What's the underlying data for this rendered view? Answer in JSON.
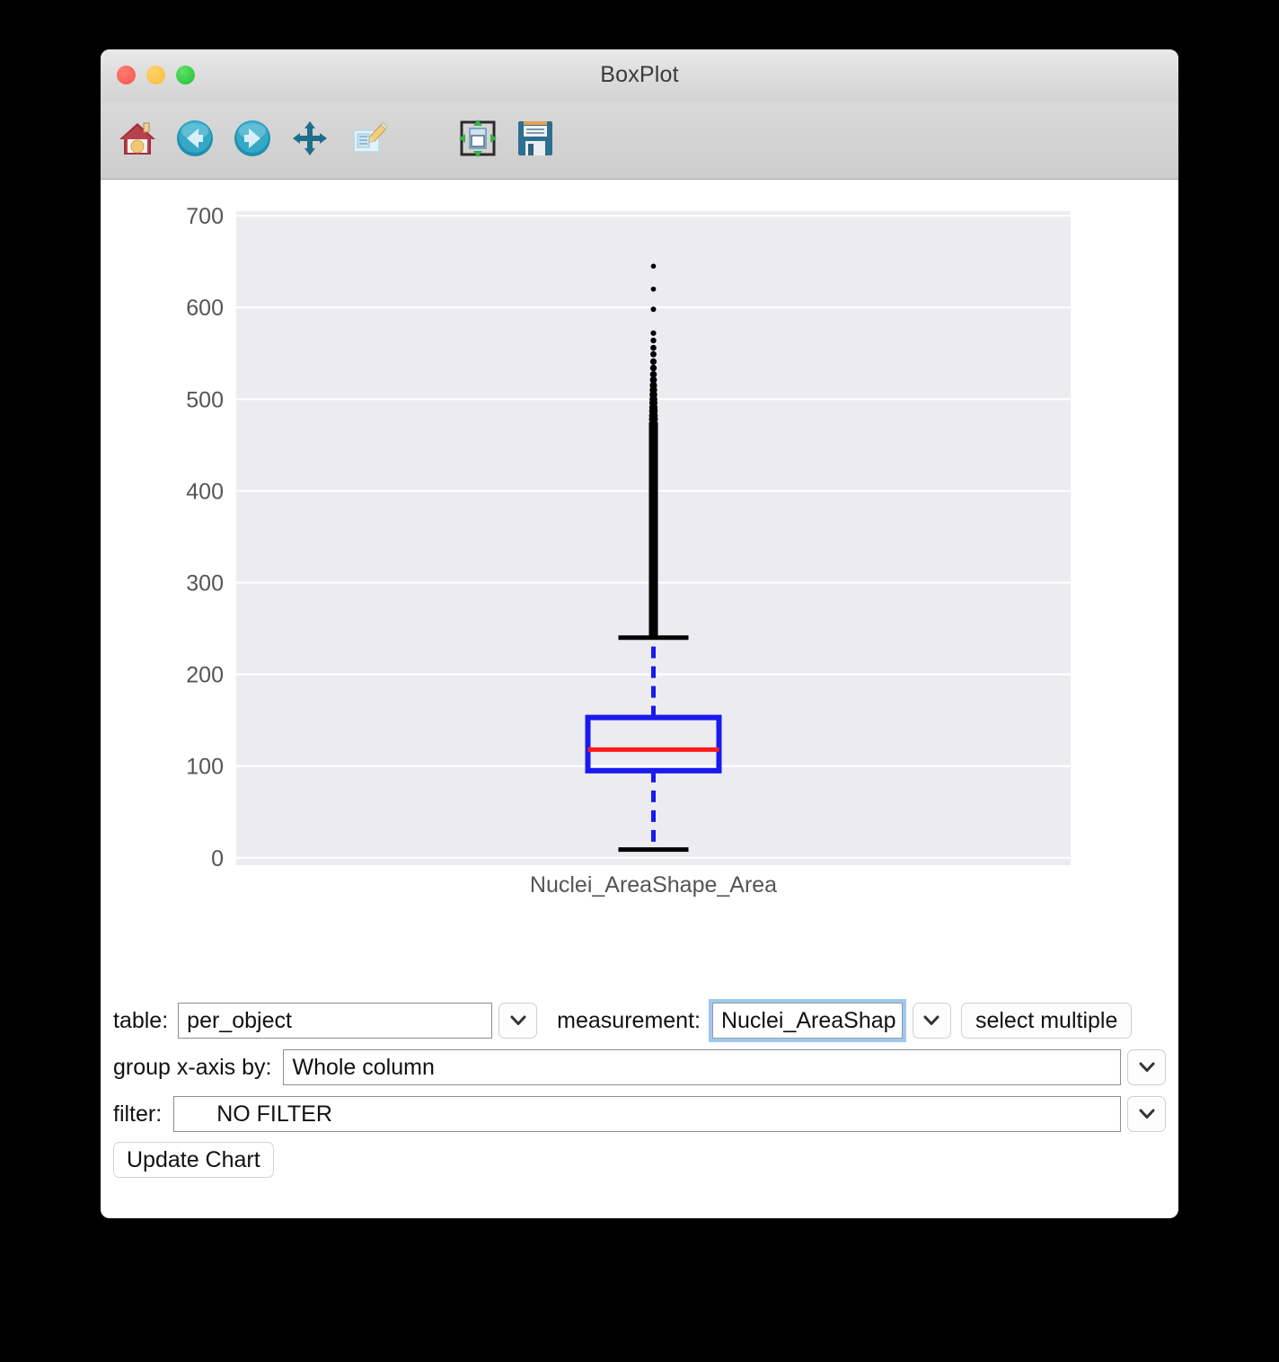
{
  "window": {
    "title": "BoxPlot",
    "traffic_lights": [
      {
        "name": "close-button",
        "color": "#f9564c"
      },
      {
        "name": "minimize-button",
        "color": "#f7bb34"
      },
      {
        "name": "zoom-button",
        "color": "#24c12f"
      }
    ]
  },
  "toolbar": {
    "buttons": [
      {
        "icon": "home-icon",
        "tooltip": "Reset original view"
      },
      {
        "icon": "back-arrow-icon",
        "tooltip": "Back to previous view"
      },
      {
        "icon": "forward-arrow-icon",
        "tooltip": "Forward to next view"
      },
      {
        "icon": "pan-move-icon",
        "tooltip": "Pan axes with left mouse, zoom with right"
      },
      {
        "icon": "zoom-rect-pencil-icon",
        "tooltip": "Zoom to rectangle"
      },
      {
        "icon": "configure-subplots-icon",
        "tooltip": "Configure subplots"
      },
      {
        "icon": "save-floppy-icon",
        "tooltip": "Save the figure"
      }
    ]
  },
  "chart_data": {
    "type": "box",
    "title": "",
    "xlabel": "",
    "ylabel": "",
    "categories": [
      "Nuclei_AreaShape_Area"
    ],
    "xticklabels": [
      "Nuclei_AreaShape_Area"
    ],
    "yticks": [
      0,
      100,
      200,
      300,
      400,
      500,
      600,
      700
    ],
    "yticklabels": [
      "0",
      "100",
      "200",
      "300",
      "400",
      "500",
      "600",
      "700"
    ],
    "ylim": [
      -8,
      705
    ],
    "grid": true,
    "grid_axis": "y",
    "legend": "none",
    "style": {
      "axes_facecolor": "#EBEBF0",
      "grid_color": "#FFFFFF",
      "box_edge_color": "#1A1AEE",
      "median_color": "#FF1A1A",
      "whisker_color": "#1A1AEE",
      "whisker_style": "dashed",
      "cap_color": "#000000",
      "flier_color": "#000000",
      "tick_label_color": "#555555"
    },
    "boxes": [
      {
        "label": "Nuclei_AreaShape_Area",
        "whisker_low": 9,
        "q1": 95,
        "median": 118,
        "q3": 153,
        "whisker_high": 240,
        "flier_min": 241,
        "flier_max": 645,
        "flier_note": "dense black column of outliers from ~241 to ~475, sparse points up to ~645"
      }
    ]
  },
  "controls": {
    "table": {
      "label": "table:",
      "value": "per_object",
      "placeholder": "per_object",
      "dropdown_icon": "chevron-down-icon"
    },
    "measurement": {
      "label": "measurement:",
      "value": "Nuclei_AreaShap",
      "placeholder": "Nuclei_AreaShape_Area",
      "focused": true,
      "dropdown_icon": "chevron-down-icon",
      "select_multiple_label": "select multiple"
    },
    "group_x_axis": {
      "label": "group x-axis by:",
      "value": "Whole column",
      "placeholder": "Whole column",
      "dropdown_icon": "chevron-down-icon"
    },
    "filter": {
      "label": "filter:",
      "value": "NO FILTER",
      "placeholder": "NO FILTER",
      "dropdown_icon": "chevron-down-icon"
    },
    "update_button_label": "Update Chart"
  }
}
